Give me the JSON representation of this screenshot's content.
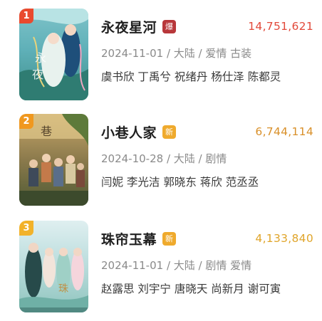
{
  "colors": {
    "rank1": "#e94a2e",
    "rank2": "#f0981f",
    "rank3": "#f2b22a",
    "hot_badge": "#b8373a",
    "new_badge": "#efaa2d",
    "count1": "#e2493a",
    "count2": "#d9902a",
    "count3": "#e0a52b"
  },
  "items": [
    {
      "rank": "1",
      "title": "永夜星河",
      "badge": "爆",
      "badge_type": "hot",
      "count": "14,751,621",
      "meta": "2024-11-01 / 大陆 / 爱情  古装",
      "cast": "虞书欣  丁禹兮  祝绪丹  杨仕泽  陈都灵",
      "poster_icon": "fantasy-poster-image"
    },
    {
      "rank": "2",
      "title": "小巷人家",
      "badge": "新",
      "badge_type": "new",
      "count": "6,744,114",
      "meta": "2024-10-28 / 大陆 / 剧情",
      "cast": "闫妮  李光洁  郭晓东  蒋欣  范丞丞",
      "poster_icon": "family-poster-image"
    },
    {
      "rank": "3",
      "title": "珠帘玉幕",
      "badge": "新",
      "badge_type": "new",
      "count": "4,133,840",
      "meta": "2024-11-01 / 大陆 / 剧情  爱情",
      "cast": "赵露思  刘宇宁  唐晓天  尚新月  谢可寅",
      "poster_icon": "costume-poster-image"
    }
  ]
}
